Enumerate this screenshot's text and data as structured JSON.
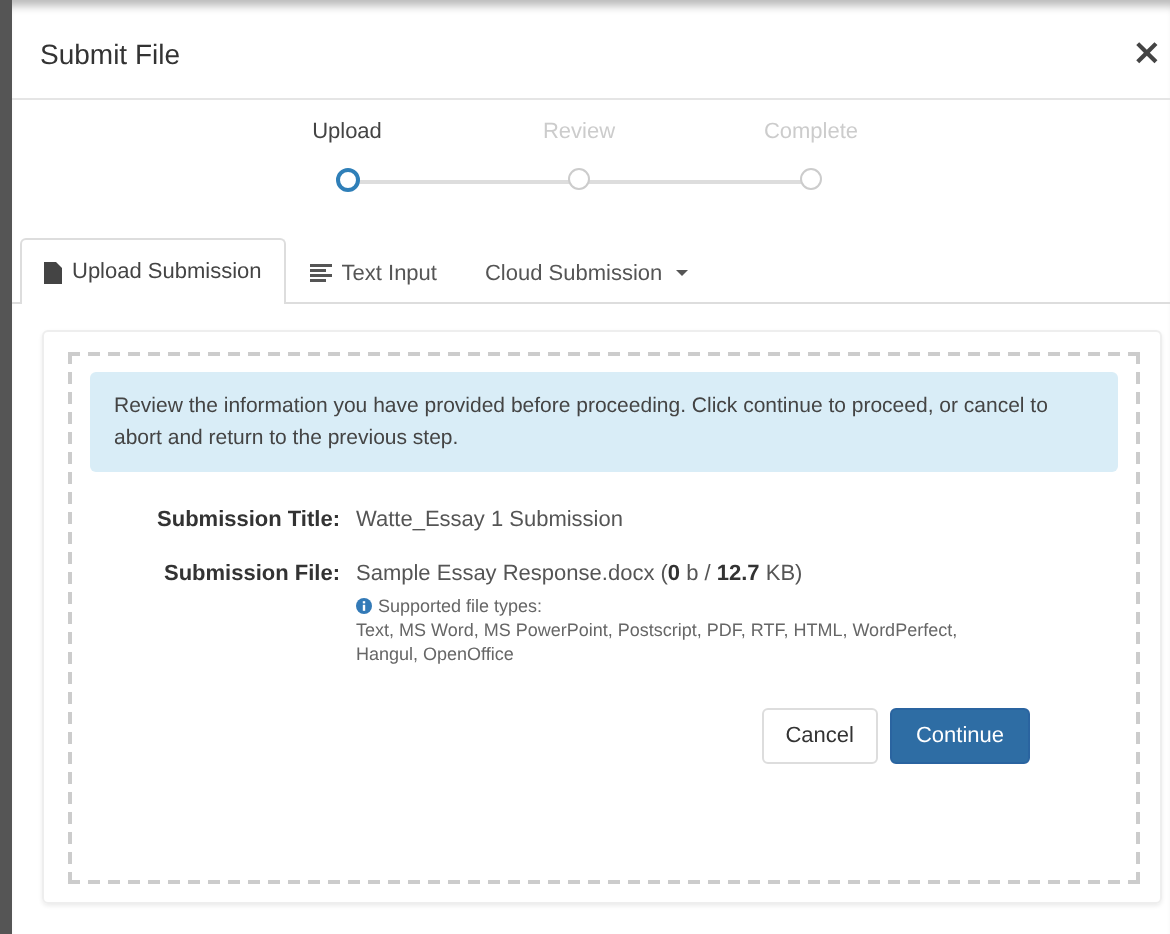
{
  "window": {
    "title": "Submit File",
    "close": "×"
  },
  "steps": [
    {
      "label": "Upload",
      "selected": true
    },
    {
      "label": "Review",
      "selected": false
    },
    {
      "label": "Complete",
      "selected": false
    }
  ],
  "tabs": [
    {
      "label": "Upload Submission",
      "kind": "file",
      "selected": true
    },
    {
      "label": "Text Input",
      "kind": "text",
      "selected": false
    },
    {
      "label": "Cloud Submission",
      "kind": "dropdown",
      "selected": false
    }
  ],
  "alert": "Review the information you have provided before proceeding. Click continue to proceed, or cancel to abort and return to the previous step.",
  "fields": [
    {
      "label": "Submission Title:",
      "value": "Watte_Essay 1 Submission"
    },
    {
      "label": "Submission File:",
      "value": "Sample Essay Response.docx (**0** b / **12.7** KB)"
    }
  ],
  "supported": {
    "label": "Supported file types:",
    "types": "Text, MS Word, MS PowerPoint, Postscript, PDF, RTF, HTML, WordPerfect, Hangul, OpenOffice"
  },
  "buttons": [
    {
      "label": "Cancel",
      "kind": "default"
    },
    {
      "label": "Continue",
      "kind": "primary"
    }
  ]
}
